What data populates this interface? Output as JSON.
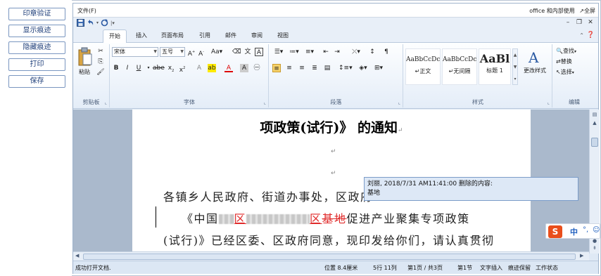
{
  "left_panel": {
    "buttons": [
      "印章验证",
      "显示痕迹",
      "隐藏痕迹",
      "打印",
      "保存"
    ]
  },
  "menubar": {
    "file": "文件(F)",
    "office_link": "office 和内部使用",
    "fullscreen": "↗全屏"
  },
  "tabs": [
    "开始",
    "插入",
    "页面布局",
    "引用",
    "邮件",
    "审阅",
    "视图"
  ],
  "active_tab": "开始",
  "ribbon": {
    "clipboard": {
      "label": "剪贴板",
      "paste": "粘贴"
    },
    "font": {
      "label": "字体",
      "font_name": "宋体",
      "font_size": "五号"
    },
    "paragraph": {
      "label": "段落"
    },
    "styles": {
      "label": "样式",
      "items": [
        {
          "sample": "AaBbCcDc",
          "name": "↵正文"
        },
        {
          "sample": "AaBbCcDc",
          "name": "↵无间隔"
        },
        {
          "sample": "AaBl",
          "name": "标题 1"
        }
      ],
      "change_styles": "更改样式"
    },
    "editing": {
      "label": "编辑",
      "find": "查找",
      "replace": "替换",
      "select": "选择"
    }
  },
  "document": {
    "title": "项政策(试行)》 的通知",
    "line1": "各镇乡人民政府、街道办事处，区政府",
    "line2_prefix": "《中国",
    "line2_ins1": "区",
    "line2_ins2": "区",
    "line2_del": "基地",
    "line2_suffix": "促进产业聚集专项政策",
    "line3": "(试行)》已经区委、区政府同意，现印发给你们，请认真贯彻"
  },
  "tooltip": {
    "header": "刘丽, 2018/7/31 AM11:41:00 删除的内容:",
    "content": "基地"
  },
  "ime": {
    "logo": "S",
    "lang": "中",
    "dots": "°,",
    "face": "☺"
  },
  "statusbar": {
    "message": "成功打开文档.",
    "position": "位置 8.4厘米",
    "row_col": "5行 11列",
    "page": "第1页 / 共3页",
    "section": "第1节",
    "insert": "文字插入",
    "track": "痕迹保留",
    "work": "工作状态"
  },
  "colors": {
    "accent": "#1f3f7a",
    "tracked_change": "#e02a2a",
    "ime_brand": "#e94e1b"
  }
}
